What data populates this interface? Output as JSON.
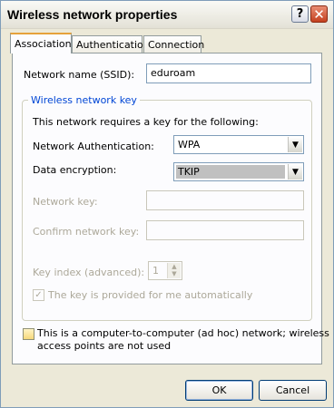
{
  "window": {
    "title": "Wireless network properties",
    "help_label": "?",
    "close_label": "✕"
  },
  "tabs": [
    {
      "label": "Association",
      "active": true
    },
    {
      "label": "Authentication",
      "active": false
    },
    {
      "label": "Connection",
      "active": false
    }
  ],
  "association": {
    "ssid_label": "Network name (SSID):",
    "ssid_value": "eduroam",
    "group_title": "Wireless network key",
    "key_requirement_text": "This network requires a key for the following:",
    "auth_label": "Network Authentication:",
    "auth_value": "WPA",
    "encryption_label": "Data encryption:",
    "encryption_value": "TKIP",
    "network_key_label": "Network key:",
    "confirm_key_label": "Confirm network key:",
    "key_index_label": "Key index (advanced):",
    "key_index_value": "1",
    "auto_key_label": "The key is provided for me automatically",
    "auto_key_checked": true,
    "adhoc_label_line1": "This is a computer-to-computer (ad hoc) network; wireless",
    "adhoc_label_line2": "access points are not used",
    "adhoc_checked": false
  },
  "buttons": {
    "ok": "OK",
    "cancel": "Cancel"
  },
  "colors": {
    "group_title": "#0046d5",
    "close_button": "#c4401f",
    "disabled_text": "#aca899"
  }
}
